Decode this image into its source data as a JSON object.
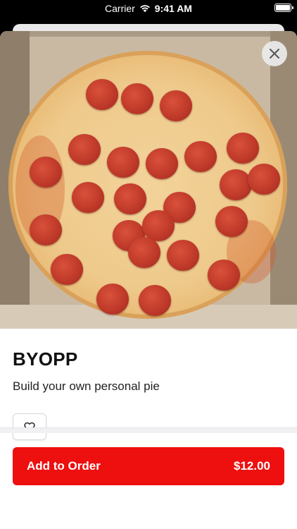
{
  "status_bar": {
    "carrier": "Carrier",
    "time": "9:41 AM",
    "battery_level": 1.0
  },
  "hero": {
    "close_icon": "close-icon"
  },
  "item": {
    "title": "BYOPP",
    "description": "Build your own personal pie",
    "favorite_icon": "heart-outline-icon"
  },
  "order_button": {
    "label": "Add to Order",
    "price": "$12.00"
  },
  "colors": {
    "accent": "#ee0f0f",
    "text": "#111111"
  }
}
